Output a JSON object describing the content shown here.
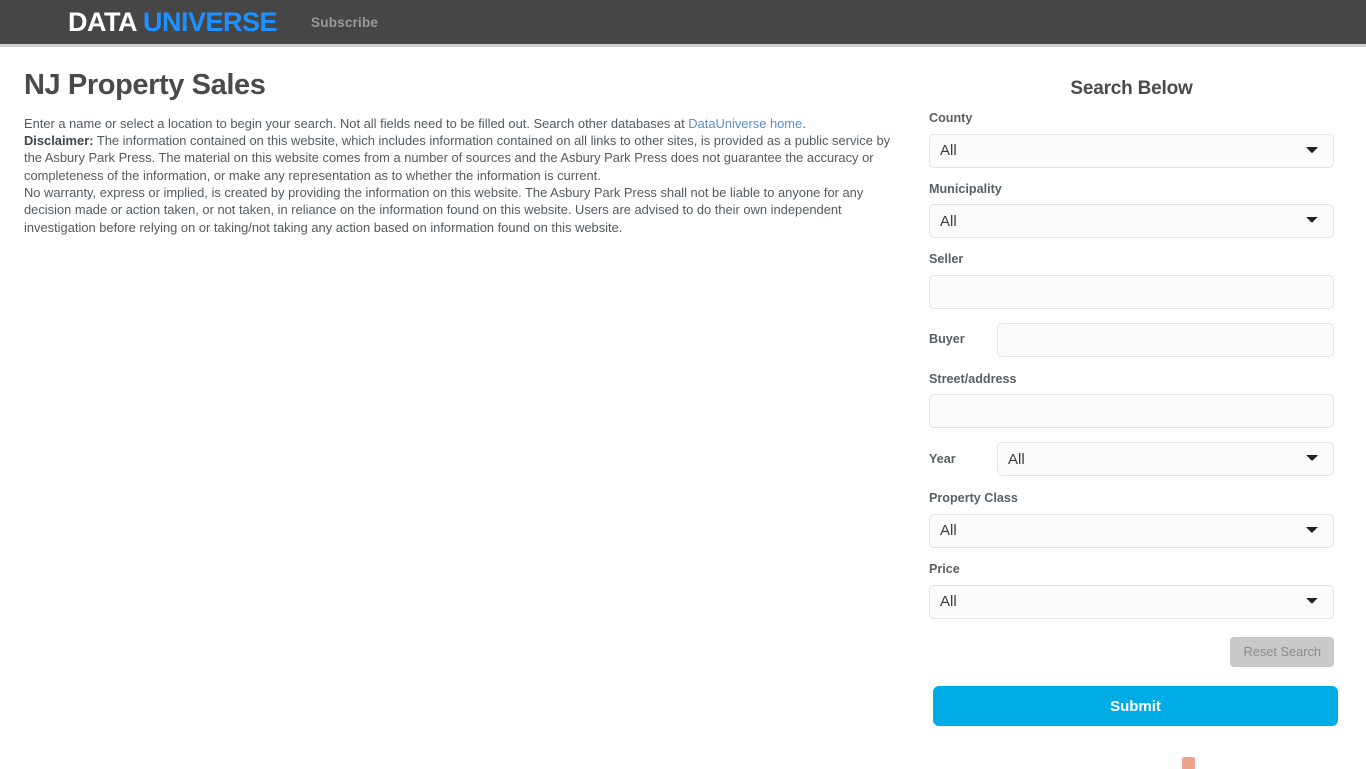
{
  "header": {
    "brand_first": "DATA",
    "brand_second": "UNIVERSE",
    "subscribe_label": "Subscribe",
    "background_color": "#464646",
    "brand_accent_color": "#1e90ff"
  },
  "main": {
    "page_title": "NJ Property Sales",
    "intro_lead": "Enter a name or select a location to begin your search. Not all fields need to be filled out. Search other databases at ",
    "intro_link_text": "DataUniverse home",
    "intro_link_suffix": ".",
    "disclaimer_label": "Disclaimer:",
    "disclaimer_body": " The information contained on this website, which includes information contained on all links to other sites, is provided as a public service by the Asbury Park Press.  The material on this website comes from a number of sources and the Asbury Park Press does not guarantee the accuracy or completeness of the information, or make any representation as to whether the information is current.",
    "warranty_text": "No warranty, express or implied, is created by providing the information on this website. The Asbury Park Press shall not be liable to anyone for any decision made or action taken, or not taken, in reliance on the information found on this website.  Users are advised to do their own independent investigation before relying on or taking/not taking any action based on information found on this website."
  },
  "search": {
    "title": "Search Below",
    "county": {
      "label": "County",
      "value": "All",
      "options": [
        "All"
      ]
    },
    "municipality": {
      "label": "Municipality",
      "value": "All",
      "options": [
        "All"
      ]
    },
    "seller": {
      "label": "Seller",
      "value": "",
      "placeholder": ""
    },
    "buyer": {
      "label": "Buyer",
      "value": "",
      "placeholder": ""
    },
    "street": {
      "label": "Street/address",
      "value": "",
      "placeholder": ""
    },
    "year": {
      "label": "Year",
      "value": "All",
      "options": [
        "All"
      ]
    },
    "property_class": {
      "label": "Property Class",
      "value": "All",
      "options": [
        "All"
      ]
    },
    "price": {
      "label": "Price",
      "value": "All",
      "options": [
        "All"
      ]
    },
    "reset_label": "Reset Search",
    "submit_label": "Submit",
    "submit_color": "#00ace5",
    "reset_color": "#c9c9c9"
  }
}
